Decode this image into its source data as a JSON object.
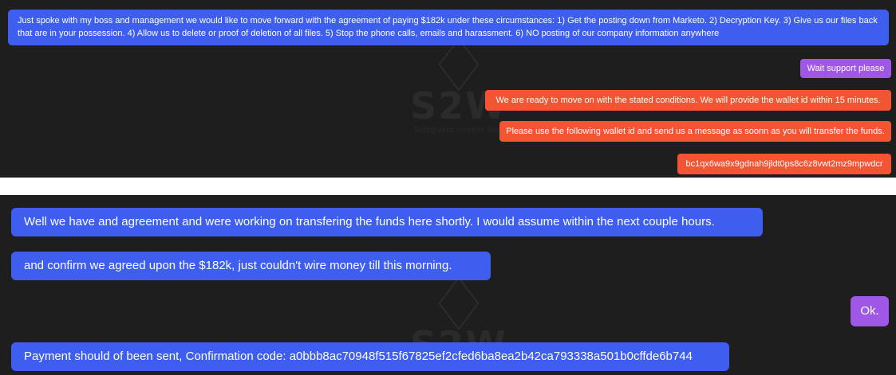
{
  "watermark": {
    "text": "S2W",
    "subtitle": "Safeguard Seeker Web"
  },
  "colors": {
    "panel_bg": "#1e1e1e",
    "victim_bubble": "#3d5eef",
    "attacker_bubble": "#f35533",
    "support_bubble": "#9f58e6"
  },
  "top_chat": {
    "messages": [
      "Just spoke with my boss and management we would like to move forward with the agreement of paying $182k under these circumstances: 1) Get the posting down from Marketo. 2) Decryption Key. 3) Give us our files back that are in your possession. 4) Allow us to delete or proof of deletion of all files. 5) Stop the phone calls, emails and harassment. 6) NO posting of our company information anywhere",
      "Wait support please",
      "We are ready to move on with the stated conditions. We will provide the wallet id within 15 minutes.",
      "Please use the following wallet id and send us a message as soonn as you will transfer the funds.",
      "bc1qx6wa9x9gdnah9jldt0ps8c6z8vwt2mz9mpwdcr"
    ]
  },
  "bottom_chat": {
    "messages": [
      "Well we have and agreement and were working on transfering the funds here shortly. I would assume within the next couple hours.",
      "and confirm we agreed upon the $182k, just couldn't wire money till this morning.",
      "Ok.",
      "Payment should of been sent, Confirmation code: a0bbb8ac70948f515f67825ef2cfed6ba8ea2b42ca793338a501b0cffde6b744"
    ]
  }
}
